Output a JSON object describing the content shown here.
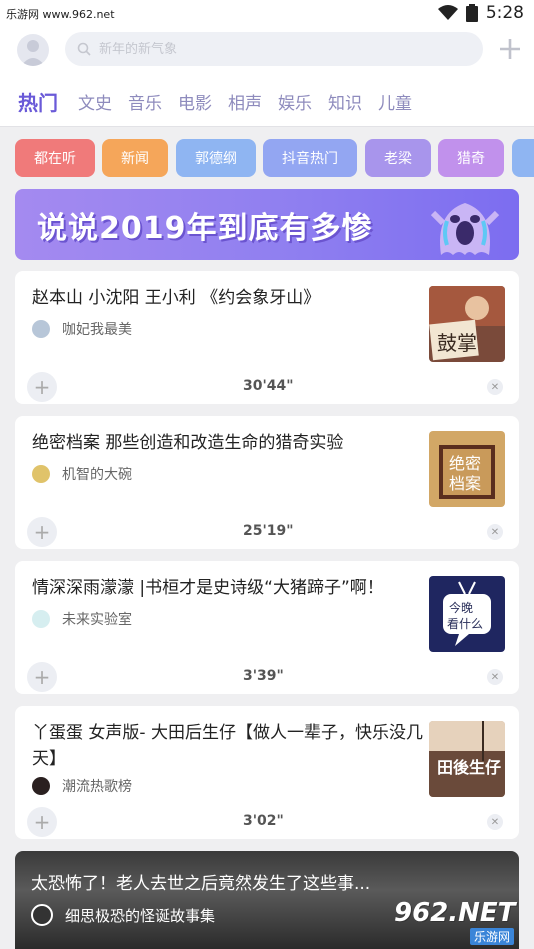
{
  "status_bar": {
    "carrier": "乐游网 www.962.net",
    "time": "5:28"
  },
  "search": {
    "placeholder": "新年的新气象"
  },
  "tabs": [
    {
      "label": "热门",
      "active": true
    },
    {
      "label": "文史"
    },
    {
      "label": "音乐"
    },
    {
      "label": "电影"
    },
    {
      "label": "相声"
    },
    {
      "label": "娱乐"
    },
    {
      "label": "知识"
    },
    {
      "label": "儿童"
    }
  ],
  "chips": [
    {
      "label": "都在听",
      "color": "#f07a7a"
    },
    {
      "label": "新闻",
      "color": "#f5a65a"
    },
    {
      "label": "郭德纲",
      "color": "#8fb5f2"
    },
    {
      "label": "抖音热门",
      "color": "#93a6f2"
    },
    {
      "label": "老梁",
      "color": "#a895ec"
    },
    {
      "label": "猎奇",
      "color": "#c191ec"
    },
    {
      "label": "",
      "color": "#8fb5f2"
    }
  ],
  "banner": {
    "text": "说说2019年到底有多惨",
    "color": "#8f7ff0"
  },
  "cards": [
    {
      "title": "赵本山 小沈阳 王小利 《约会象牙山》",
      "author": "咖妃我最美",
      "duration": "30'44\"",
      "thumb_text": "鼓掌",
      "thumb_color": "#c9a27a"
    },
    {
      "title": "绝密档案 那些创造和改造生命的猎奇实验",
      "author": "机智的大碗",
      "duration": "25'19\"",
      "thumb_text": "绝密档案",
      "thumb_color": "#b88a52"
    },
    {
      "title": "情深深雨濛濛 |书桓才是史诗级“大猪蹄子”啊！",
      "author": "未来实验室",
      "duration": "3'39\"",
      "thumb_text": "今晚看什么",
      "thumb_color": "#2a2f5a"
    },
    {
      "title": "丫蛋蛋 女声版- 大田后生仔【做人一辈子，快乐没几天】",
      "author": "潮流热歌榜",
      "duration": "3'02\"",
      "thumb_text": "田後生仔",
      "thumb_color": "#8a6a52"
    }
  ],
  "video_card": {
    "title": "太恐怖了！老人去世之后竟然发生了这些事...",
    "author": "细思极恐的怪诞故事集"
  },
  "watermark": {
    "main": "962.NET",
    "sub": "乐游网"
  }
}
